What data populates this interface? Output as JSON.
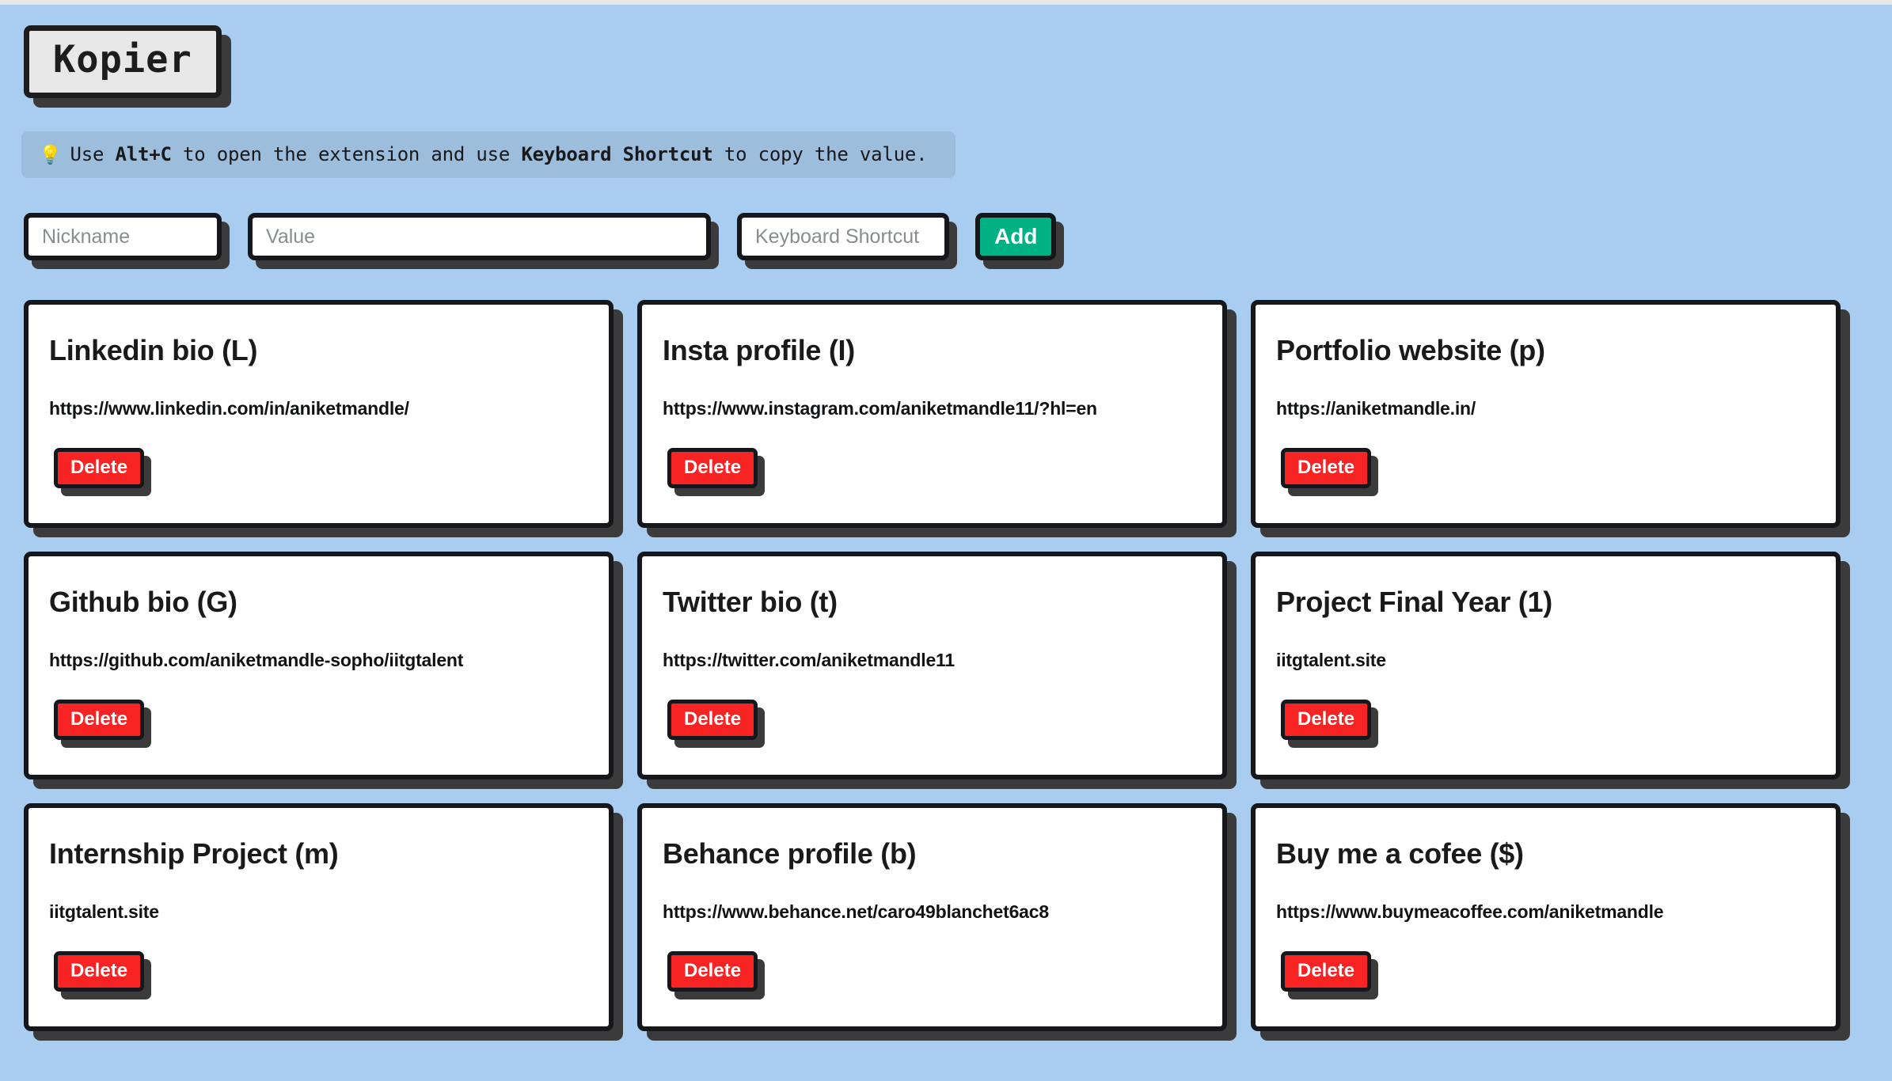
{
  "app": {
    "title": "Kopier",
    "background_color": "#a9cdf1",
    "accent_add_color": "#00b184",
    "accent_delete_color": "#f82323"
  },
  "tip": {
    "bulb_icon": "💡",
    "text_before": "Use ",
    "shortcut_key": "Alt+C",
    "text_middle": " to open the extension and use ",
    "shortcut_label": "Keyboard Shortcut",
    "text_after": " to copy the value."
  },
  "form": {
    "nickname_placeholder": "Nickname",
    "nickname_value": "",
    "value_placeholder": "Value",
    "value_value": "",
    "shortcut_placeholder": "Keyboard Shortcut",
    "shortcut_value": "",
    "add_label": "Add"
  },
  "cards": [
    {
      "title": "Linkedin bio (L)",
      "value": "https://www.linkedin.com/in/aniketmandle/",
      "delete_label": "Delete"
    },
    {
      "title": "Insta profile (I)",
      "value": "https://www.instagram.com/aniketmandle11/?hl=en",
      "delete_label": "Delete"
    },
    {
      "title": "Portfolio website (p)",
      "value": "https://aniketmandle.in/",
      "delete_label": "Delete"
    },
    {
      "title": "Github bio (G)",
      "value": "https://github.com/aniketmandle-sopho/iitgtalent",
      "delete_label": "Delete"
    },
    {
      "title": "Twitter bio (t)",
      "value": "https://twitter.com/aniketmandle11",
      "delete_label": "Delete"
    },
    {
      "title": "Project Final Year (1)",
      "value": "iitgtalent.site",
      "delete_label": "Delete"
    },
    {
      "title": "Internship Project (m)",
      "value": "iitgtalent.site",
      "delete_label": "Delete"
    },
    {
      "title": "Behance profile (b)",
      "value": "https://www.behance.net/caro49blanchet6ac8",
      "delete_label": "Delete"
    },
    {
      "title": "Buy me a cofee ($)",
      "value": "https://www.buymeacoffee.com/aniketmandle",
      "delete_label": "Delete"
    }
  ]
}
